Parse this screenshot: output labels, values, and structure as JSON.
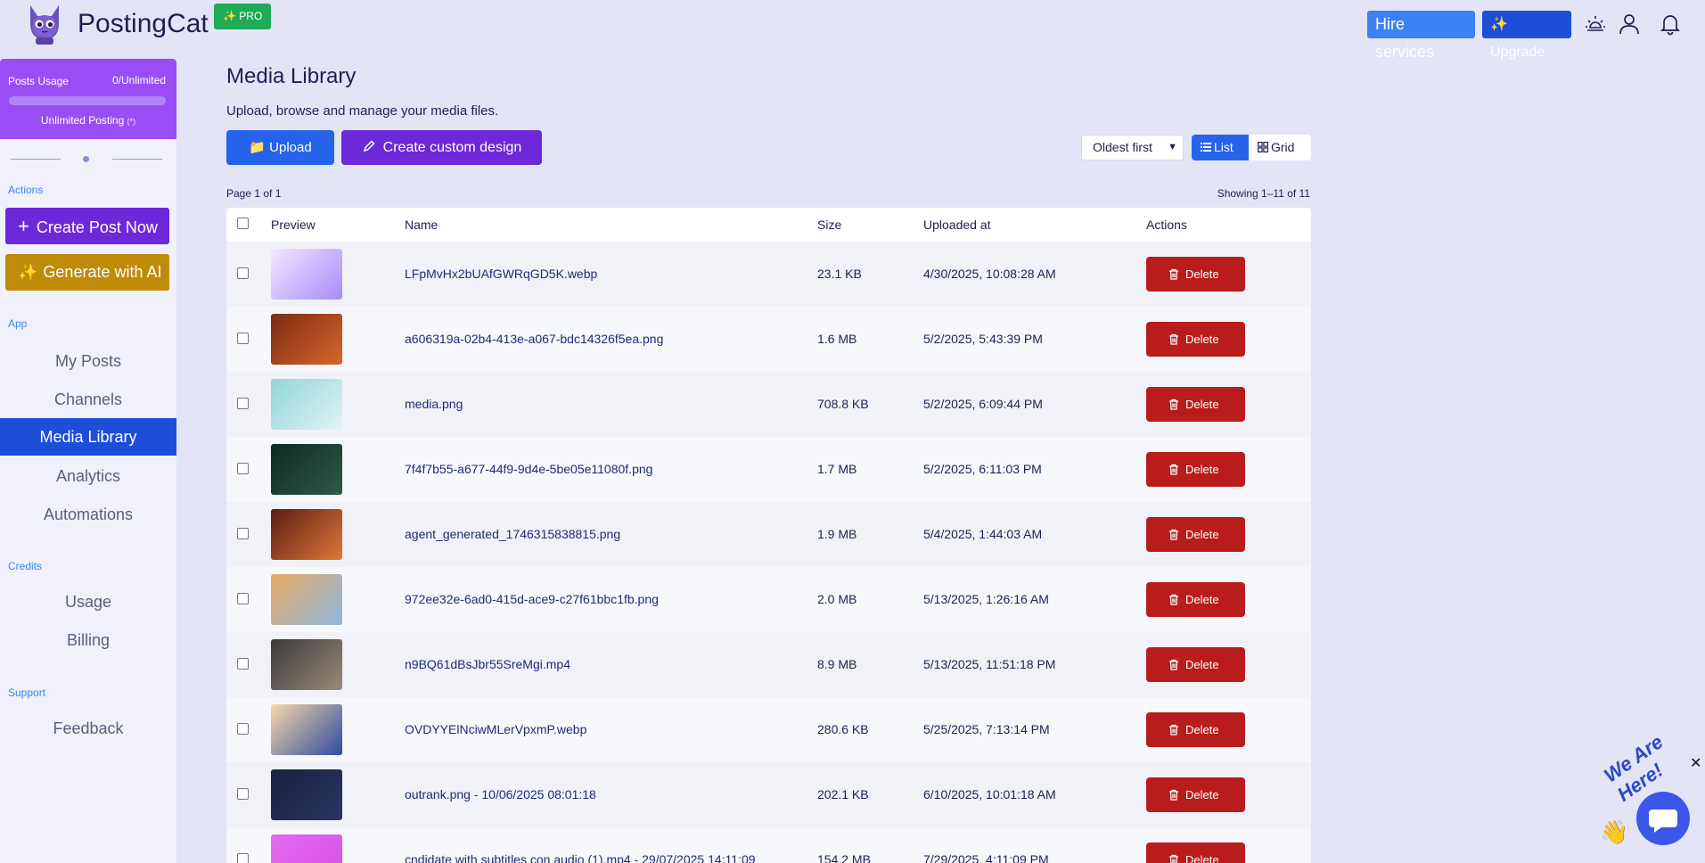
{
  "header": {
    "brand": "PostingCat",
    "pro_badge": "✨ PRO",
    "hire_label": "Hire services",
    "upgrade_label": "✨ Upgrade",
    "icons": [
      "theme-toggle-icon",
      "user-icon",
      "bell-icon"
    ]
  },
  "sidebar": {
    "usage": {
      "label": "Posts Usage",
      "count": "0/Unlimited",
      "progress_fraction": 0,
      "unlimited_text": "Unlimited Posting",
      "unlimited_note": "(*)"
    },
    "sections": {
      "actions": "Actions",
      "app": "App",
      "credits": "Credits",
      "support": "Support"
    },
    "create_post": "Create Post Now",
    "generate_ai": "Generate with AI",
    "app_items": [
      "My Posts",
      "Channels",
      "Media Library",
      "Analytics",
      "Automations"
    ],
    "active_item": "Media Library",
    "credits_items": [
      "Usage",
      "Billing"
    ],
    "support_items": [
      "Feedback"
    ]
  },
  "main": {
    "title": "Media Library",
    "description": "Upload, browse and manage your media files.",
    "upload_label": "📁 Upload",
    "custom_design_label": "Create custom design",
    "sort_value": "Oldest first",
    "view_list": "List",
    "view_grid": "Grid",
    "page_info": "Page 1 of 1",
    "showing": "Showing 1–11 of 11",
    "columns": [
      "Preview",
      "Name",
      "Size",
      "Uploaded at",
      "Actions"
    ],
    "delete_label": "Delete",
    "rows": [
      {
        "name": "LFpMvHx2bUAfGWRqGD5K.webp",
        "size": "23.1 KB",
        "uploaded": "4/30/2025, 10:08:28 AM",
        "thumb": [
          "#f3e8ff",
          "#a78bfa"
        ]
      },
      {
        "name": "a606319a-02b4-413e-a067-bdc14326f5ea.png",
        "size": "1.6 MB",
        "uploaded": "5/2/2025, 5:43:39 PM",
        "thumb": [
          "#7a2a12",
          "#d9662b"
        ]
      },
      {
        "name": "media.png",
        "size": "708.8 KB",
        "uploaded": "5/2/2025, 6:09:44 PM",
        "thumb": [
          "#8fd6d8",
          "#e4f2f4"
        ]
      },
      {
        "name": "7f4f7b55-a677-44f9-9d4e-5be05e11080f.png",
        "size": "1.7 MB",
        "uploaded": "5/2/2025, 6:11:03 PM",
        "thumb": [
          "#0d2a22",
          "#2f5a48"
        ]
      },
      {
        "name": "agent_generated_1746315838815.png",
        "size": "1.9 MB",
        "uploaded": "5/4/2025, 1:44:03 AM",
        "thumb": [
          "#5a1c12",
          "#e0783a"
        ]
      },
      {
        "name": "972ee32e-6ad0-415d-ace9-c27f61bbc1fb.png",
        "size": "2.0 MB",
        "uploaded": "5/13/2025, 1:26:16 AM",
        "thumb": [
          "#e8a860",
          "#8fb8e0"
        ]
      },
      {
        "name": "n9BQ61dBsJbr55SreMgi.mp4",
        "size": "8.9 MB",
        "uploaded": "5/13/2025, 11:51:18 PM",
        "thumb": [
          "#3a3a3a",
          "#9a8a7a"
        ]
      },
      {
        "name": "OVDYYElNciwMLerVpxmP.webp",
        "size": "280.6 KB",
        "uploaded": "5/25/2025, 7:13:14 PM",
        "thumb": [
          "#f6d9a8",
          "#2f4aa0"
        ]
      },
      {
        "name": "outrank.png - 10/06/2025 08:01:18",
        "size": "202.1 KB",
        "uploaded": "6/10/2025, 10:01:18 AM",
        "thumb": [
          "#1a2240",
          "#2a3460"
        ]
      },
      {
        "name": "cndidate with subtitles con audio (1).mp4 - 29/07/2025 14:11:09",
        "size": "154.2 MB",
        "uploaded": "7/29/2025, 4:11:09 PM",
        "thumb": [
          "#e46af0",
          "#d94fe6"
        ]
      }
    ]
  },
  "chat": {
    "close": "✕",
    "tagline": "We Are Here!",
    "wave": "👋"
  },
  "colors": {
    "primary": "#2563eb",
    "purple": "#6d28d9",
    "danger": "#b91c1c",
    "gold": "#c08a0a",
    "background": "#e3e4f6"
  }
}
